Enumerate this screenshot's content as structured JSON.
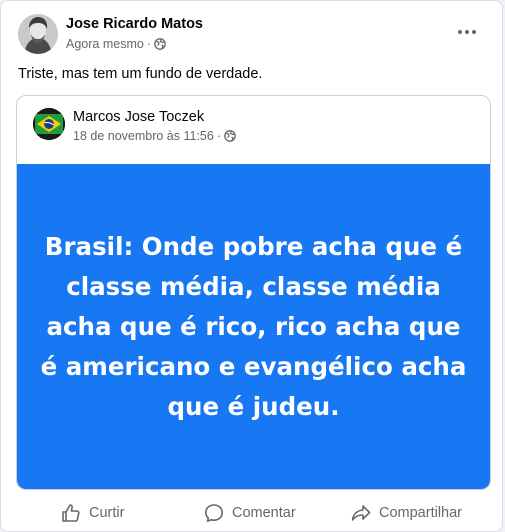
{
  "post": {
    "author": "Jose Ricardo Matos",
    "time": "Agora mesmo",
    "separator": "·",
    "privacy_icon": "globe-icon",
    "text": "Triste, mas tem um fundo de verdade."
  },
  "shared_post": {
    "author": "Marcos Jose Toczek",
    "time": "18 de novembro às 11:56",
    "separator": "·",
    "privacy_icon": "globe-icon",
    "quote": "Brasil: Onde pobre acha que é classe média, classe média acha que é rico, rico acha que é americano e evangélico acha que é judeu.",
    "background_color": "#1877f2"
  },
  "actions": {
    "like": "Curtir",
    "comment": "Comentar",
    "share": "Compartilhar"
  }
}
